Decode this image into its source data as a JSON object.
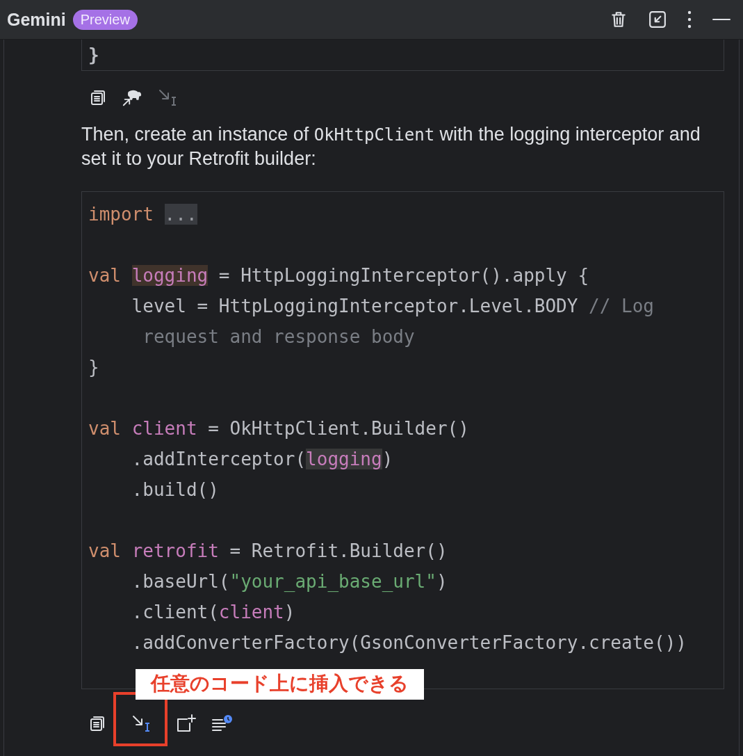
{
  "header": {
    "title": "Gemini",
    "badge": "Preview",
    "actions": [
      {
        "kind": "trash"
      },
      {
        "kind": "collapse"
      },
      {
        "kind": "more"
      },
      {
        "kind": "minimize"
      }
    ]
  },
  "previous_code": {
    "lines": [
      {
        "tokens": [
          {
            "kind": "plain",
            "text": "}"
          }
        ]
      }
    ]
  },
  "toolbar_1": [
    {
      "kind": "copy",
      "disabled": false
    },
    {
      "kind": "gradle",
      "disabled": false
    },
    {
      "kind": "insert",
      "disabled": true
    }
  ],
  "paragraph": {
    "parts": [
      {
        "kind": "prose",
        "text": "Then, create an instance of "
      },
      {
        "kind": "code",
        "text": "OkHttpClient"
      },
      {
        "kind": "prose",
        "text": " with the logging interceptor and set it to your Retrofit builder:"
      }
    ]
  },
  "code_block": {
    "lines": [
      {
        "tokens": [
          {
            "kind": "keyword",
            "text": "import "
          },
          {
            "kind": "fold",
            "text": "..."
          }
        ],
        "blank_after": true
      },
      {
        "tokens": [
          {
            "kind": "keyword",
            "text": "val "
          },
          {
            "kind": "field_declaration",
            "text": "logging"
          },
          {
            "kind": "plain",
            "text": " = HttpLoggingInterceptor().apply {"
          }
        ],
        "blank_after": false
      },
      {
        "tokens": [
          {
            "kind": "plain",
            "text": "    level = HttpLoggingInterceptor.Level.BODY "
          },
          {
            "kind": "comment",
            "text": "// Log"
          }
        ],
        "blank_after": false
      },
      {
        "tokens": [
          {
            "kind": "comment",
            "text": "     request and response body"
          }
        ],
        "blank_after": false
      },
      {
        "tokens": [
          {
            "kind": "plain",
            "text": "}"
          }
        ],
        "blank_after": true
      },
      {
        "tokens": [
          {
            "kind": "keyword",
            "text": "val "
          },
          {
            "kind": "field",
            "text": "client"
          },
          {
            "kind": "plain",
            "text": " = OkHttpClient.Builder()"
          }
        ],
        "blank_after": false
      },
      {
        "tokens": [
          {
            "kind": "plain",
            "text": "    .addInterceptor("
          },
          {
            "kind": "field_reference",
            "text": "logging"
          },
          {
            "kind": "plain",
            "text": ")"
          }
        ],
        "blank_after": false
      },
      {
        "tokens": [
          {
            "kind": "plain",
            "text": "    .build()"
          }
        ],
        "blank_after": true
      },
      {
        "tokens": [
          {
            "kind": "keyword",
            "text": "val "
          },
          {
            "kind": "field",
            "text": "retrofit"
          },
          {
            "kind": "plain",
            "text": " = Retrofit.Builder()"
          }
        ],
        "blank_after": false
      },
      {
        "tokens": [
          {
            "kind": "plain",
            "text": "    .baseUrl("
          },
          {
            "kind": "string",
            "text": "\"your_api_base_url\""
          },
          {
            "kind": "plain",
            "text": ")"
          }
        ],
        "blank_after": false
      },
      {
        "tokens": [
          {
            "kind": "plain",
            "text": "    .client("
          },
          {
            "kind": "field",
            "text": "client"
          },
          {
            "kind": "plain",
            "text": ")"
          }
        ],
        "blank_after": false
      },
      {
        "tokens": [
          {
            "kind": "plain",
            "text": "    .addConverterFactory(GsonConverterFactory.create())"
          }
        ],
        "blank_after": false
      }
    ]
  },
  "toolbar_2": [
    {
      "kind": "copy",
      "disabled": false,
      "callout": false
    },
    {
      "kind": "insert",
      "disabled": false,
      "callout": true
    },
    {
      "kind": "new-file",
      "disabled": false,
      "callout": false
    },
    {
      "kind": "explain",
      "disabled": false,
      "callout": false
    }
  ],
  "annotation": {
    "text": "任意のコード上に挿入できる"
  }
}
